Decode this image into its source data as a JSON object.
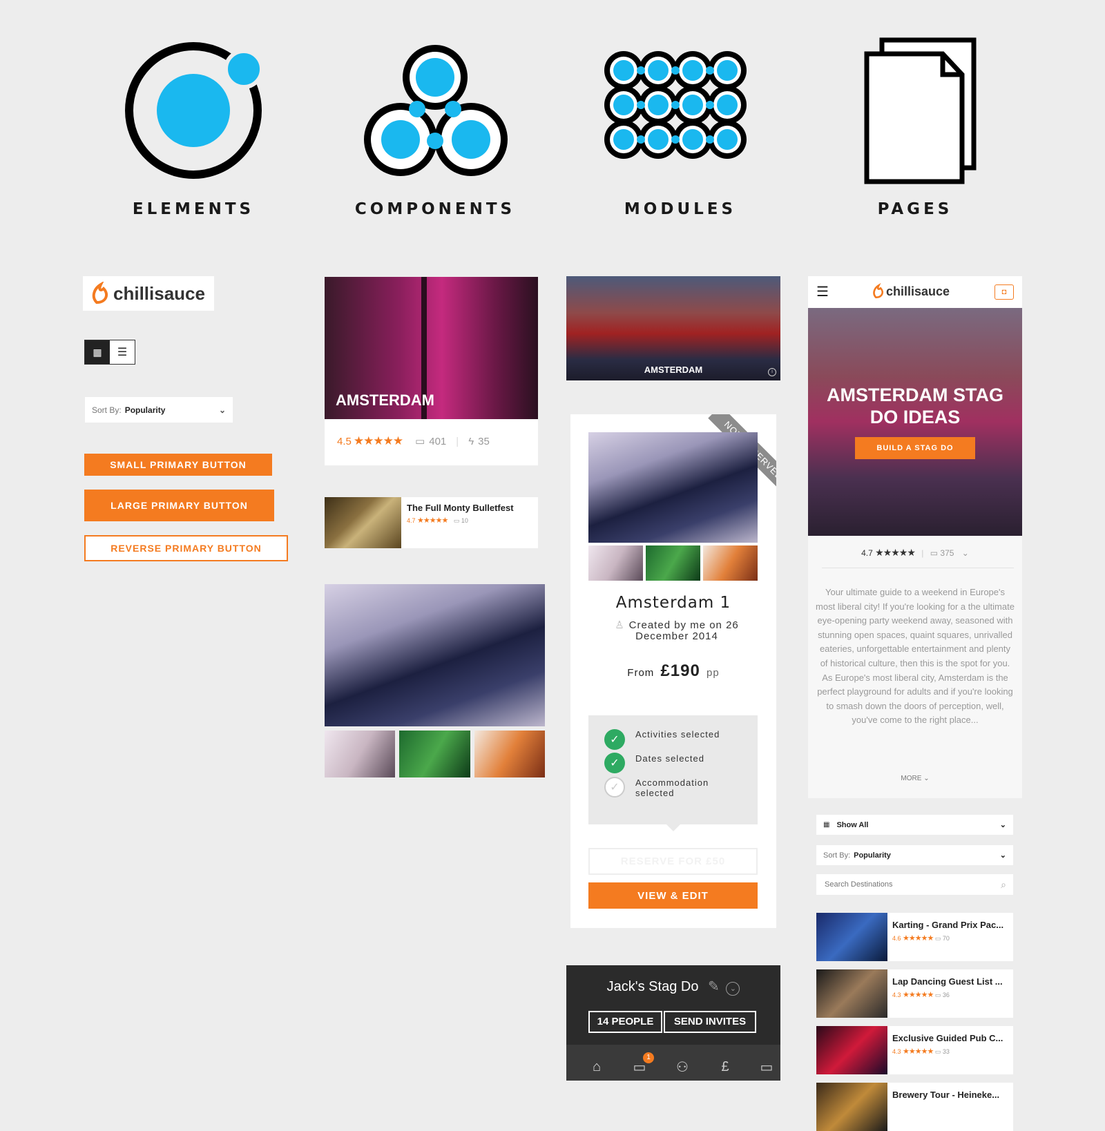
{
  "sections": {
    "elements": "ELEMENTS",
    "components": "COMPONENTS",
    "modules": "MODULES",
    "pages": "PAGES"
  },
  "brand": {
    "logo_text": "chillisauce",
    "accent": "#f47b20",
    "icon_blue": "#1ab8ef",
    "dark": "#2b2b2b",
    "success": "#2eaa62"
  },
  "elements": {
    "sort_label": "Sort By:",
    "sort_value": "Popularity",
    "small_button": "SMALL PRIMARY BUTTON",
    "large_button": "LARGE PRIMARY BUTTON",
    "reverse_button": "REVERSE PRIMARY BUTTON"
  },
  "components": {
    "city_card": {
      "title": "AMSTERDAM",
      "rating": "4.5",
      "comments": "401",
      "activities": "35"
    },
    "activity_card": {
      "title": "The Full Monty Bulletfest",
      "rating": "4.7",
      "comments": "10"
    }
  },
  "modules": {
    "city_banner": {
      "title": "AMSTERDAM"
    },
    "trip_card": {
      "ribbon": "NOT RESERVED",
      "title": "Amsterdam 1",
      "created": "Created by me on 26 December 2014",
      "from_label": "From",
      "price": "£190",
      "pp": "pp",
      "checklist": [
        {
          "label": "Activities selected",
          "done": true
        },
        {
          "label": "Dates selected",
          "done": true
        },
        {
          "label": "Accommodation selected",
          "done": false
        }
      ],
      "reserve_button": "RESERVE FOR £50",
      "view_button": "VIEW & EDIT"
    },
    "stag_bar": {
      "title": "Jack's Stag Do",
      "people_button": "14 PEOPLE",
      "invite_button": "SEND INVITES",
      "badge": "1"
    }
  },
  "pages": {
    "hero_title": "AMSTERDAM STAG DO IDEAS",
    "hero_button": "BUILD A STAG DO",
    "rating": "4.7",
    "comments": "375",
    "description": "Your ultimate guide to a weekend in Europe's most liberal city! If you're looking for a the ultimate eye-opening party weekend away, seasoned with stunning open spaces, quaint squares, unrivalled eateries, unforgettable entertainment and plenty of historical culture, then this is the spot for you. As Europe's most liberal city, Amsterdam is the perfect playground for adults and if you're looking to smash down the doors of perception, well, you've come to the right place...",
    "more": "MORE",
    "filter_value": "Show All",
    "sort_label": "Sort By:",
    "sort_value": "Popularity",
    "search_placeholder": "Search Destinations",
    "results": [
      {
        "title": "Karting - Grand Prix Pac...",
        "rating": "4.6",
        "comments": "70"
      },
      {
        "title": "Lap Dancing Guest List ...",
        "rating": "4.3",
        "comments": "36"
      },
      {
        "title": "Exclusive Guided Pub C...",
        "rating": "4.3",
        "comments": "33"
      },
      {
        "title": "Brewery Tour - Heineke...",
        "rating": "",
        "comments": ""
      }
    ]
  }
}
